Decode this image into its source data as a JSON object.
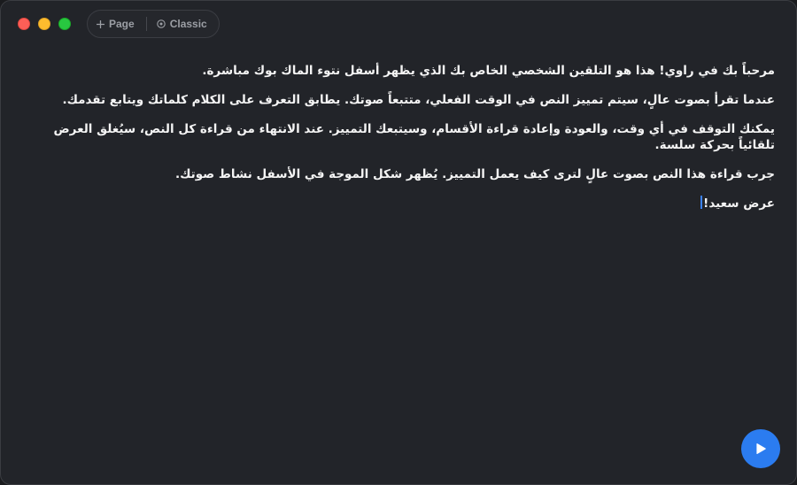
{
  "colors": {
    "window_bg": "#222429",
    "text": "#f4f4f4",
    "accent": "#2b7cf0",
    "toolbar_text": "#9c9fa5"
  },
  "window_controls": {
    "close": "close-icon",
    "minimize": "minimize-icon",
    "maximize": "maximize-icon"
  },
  "toolbar": {
    "page_label": "Page",
    "page_icon": "plus-icon",
    "classic_label": "Classic",
    "classic_icon": "target-circle-icon"
  },
  "script": {
    "paragraphs": [
      "مرحباً بك في راوي! هذا هو التلقين الشخصي الخاص بك الذي يظهر أسفل نتوء الماك بوك مباشرة.",
      "عندما تقرأ بصوت عالٍ، سيتم تمييز النص في الوقت الفعلي، متتبعاً صوتك. يطابق التعرف على الكلام كلماتك ويتابع تقدمك.",
      "يمكنك التوقف في أي وقت، والعودة وإعادة قراءة الأقسام، وسيتبعك التمييز. عند الانتهاء من قراءة كل النص، سيُغلق العرض تلقائياً بحركة سلسة.",
      "جرب قراءة هذا النص بصوت عالٍ لترى كيف يعمل التمييز. يُظهر شكل الموجة في الأسفل نشاط صوتك."
    ],
    "last_line": "عرض سعيد!"
  },
  "play_button": {
    "icon": "play-icon"
  }
}
